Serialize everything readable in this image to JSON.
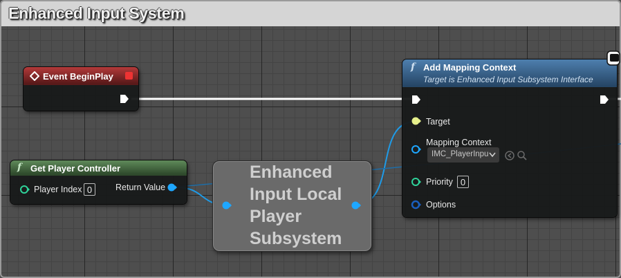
{
  "comment": {
    "title": "Enhanced Input System"
  },
  "event_begin_play": {
    "title": "Event BeginPlay"
  },
  "get_player_controller": {
    "title": "Get Player Controller",
    "player_index_label": "Player Index",
    "player_index_value": "0",
    "return_value_label": "Return Value"
  },
  "subsystem_node": {
    "label": "Enhanced Input Local Player Subsystem"
  },
  "add_mapping_context": {
    "title": "Add Mapping Context",
    "subtitle": "Target is Enhanced Input Subsystem Interface",
    "target_label": "Target",
    "mapping_context_label": "Mapping Context",
    "mapping_context_value": "IMC_PlayerInpu",
    "priority_label": "Priority",
    "priority_value": "0",
    "options_label": "Options"
  },
  "colors": {
    "exec": "#ffffff",
    "object_pin": "#1ea7ff",
    "target_pin": "#e6f08c",
    "integer_pin": "#2fd39a",
    "struct_pin": "#1a5fbf"
  }
}
